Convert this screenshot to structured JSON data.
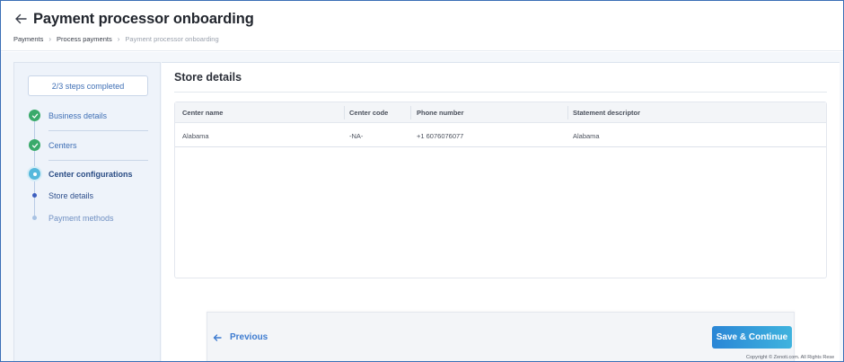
{
  "header": {
    "title": "Payment processor onboarding",
    "breadcrumb": [
      "Payments",
      "Process payments",
      "Payment processor onboarding"
    ]
  },
  "sidebar": {
    "progress": "2/3 steps completed",
    "steps": [
      {
        "label": "Business details",
        "status": "done"
      },
      {
        "label": "Centers",
        "status": "done"
      },
      {
        "label": "Center configurations",
        "status": "active"
      }
    ],
    "substeps": [
      {
        "label": "Store details",
        "status": "current"
      },
      {
        "label": "Payment methods",
        "status": "upcoming"
      }
    ]
  },
  "main": {
    "section_title": "Store details",
    "table": {
      "columns": [
        "Center name",
        "Center code",
        "Phone number",
        "Statement descriptor"
      ],
      "rows": [
        [
          "Alabama",
          "-NA-",
          "+1 6076076077",
          "Alabama"
        ]
      ]
    }
  },
  "footer": {
    "previous_label": "Previous",
    "save_label": "Save & Continue"
  },
  "copyright": "Copyright © Zenoti.com. All Rights Rese",
  "colors": {
    "accent": "#3d7bd0",
    "done": "#3aaa6b",
    "active": "#56b8dc"
  }
}
